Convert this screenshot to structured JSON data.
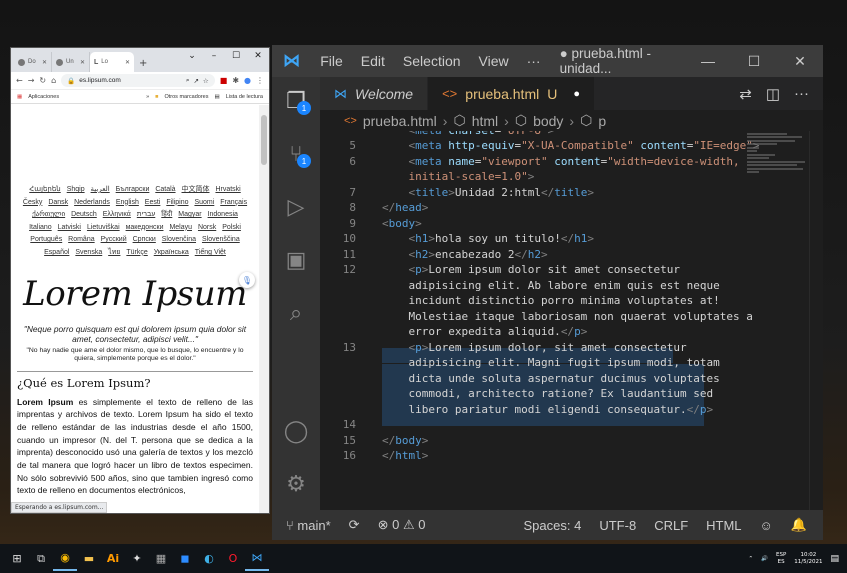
{
  "browser": {
    "tabs": [
      {
        "label": "Do",
        "active": false
      },
      {
        "label": "Un",
        "active": false
      },
      {
        "label": "Lo",
        "active": true
      }
    ],
    "url": "es.lipsum.com",
    "bookmarks": [
      "Aplicaciones",
      "Otros marcadores",
      "Lista de lectura"
    ],
    "languages": [
      "Հայերեն",
      "Shqip",
      "العربية",
      "Български",
      "Català",
      "中文简体",
      "Hrvatski",
      "Česky",
      "Dansk",
      "Nederlands",
      "English",
      "Eesti",
      "Filipino",
      "Suomi",
      "Français",
      "ქართული",
      "Deutsch",
      "Ελληνικά",
      "עברית",
      "हिंदी",
      "Magyar",
      "Indonesia",
      "Italiano",
      "Latviski",
      "Lietuviškai",
      "македонски",
      "Melayu",
      "Norsk",
      "Polski",
      "Português",
      "Româna",
      "Pyccкий",
      "Српски",
      "Slovenčina",
      "Slovenščina",
      "Español",
      "Svenska",
      "ไทย",
      "Türkçe",
      "Українська",
      "Tiếng Việt"
    ],
    "page_title": "Lorem Ipsum",
    "quote_latin": "\"Neque porro quisquam est qui dolorem ipsum quia dolor sit amet, consectetur, adipisci velit...\"",
    "quote_spanish": "\"No hay nadie que ame el dolor mismo, que lo busque, lo encuentre y lo quiera, simplemente porque es el dolor.\"",
    "section_heading": "¿Qué es Lorem Ipsum?",
    "section_bold": "Lorem Ipsum",
    "section_text": " es simplemente el texto de relleno de las imprentas y archivos de texto. Lorem Ipsum ha sido el texto de relleno estándar de las industrias desde el año 1500, cuando un impresor (N. del T. persona que se dedica a la imprenta) desconocido usó una galería de textos y los mezcló de tal manera que logró hacer un libro de textos especimen. No sólo sobrevivió 500 años, sino que tambien ingresó como texto de relleno en documentos electrónicos,",
    "status": "Esperando a es.lipsum.com..."
  },
  "vscode": {
    "menu": [
      "File",
      "Edit",
      "Selection",
      "View",
      "···"
    ],
    "window_title": "● prueba.html - unidad...",
    "tabs": [
      {
        "label": "Welcome",
        "active": false
      },
      {
        "label": "prueba.html",
        "badge": "U",
        "active": true
      }
    ],
    "breadcrumb": [
      "prueba.html",
      "html",
      "body",
      "p"
    ],
    "activity_badges": {
      "explorer": "1",
      "scm": "1"
    },
    "status": {
      "branch": "main*",
      "problems": "0",
      "warnings": "0",
      "spaces": "Spaces: 4",
      "encoding": "UTF-8",
      "eol": "CRLF",
      "language": "HTML"
    }
  },
  "taskbar": {
    "lang_top": "ESP",
    "lang_bottom": "ES",
    "time": "10:02",
    "date": "11/5/2021"
  },
  "colors": {
    "vscode_accent": "#3ea5f5",
    "tag": "#569cd6",
    "attr": "#9cdcfe",
    "string": "#ce9178"
  }
}
